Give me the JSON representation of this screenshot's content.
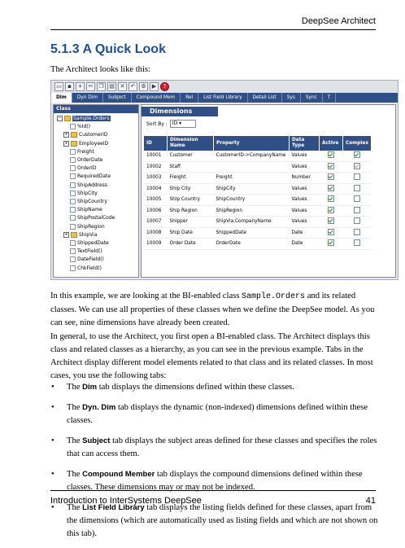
{
  "header": {
    "running_title": "DeepSee Architect"
  },
  "section_title": "5.1.3 A Quick Look",
  "intro": "The Architect looks like this:",
  "screenshot": {
    "tabs": [
      "Dim",
      "Dyn Dim",
      "Subject",
      "Compound Mem",
      "Rel",
      "List Field Library",
      "Detail List",
      "Sys",
      "Sync",
      "T"
    ],
    "class_panel_title": "Class",
    "tree": [
      {
        "label": "Sample.Orders",
        "kind": "root",
        "selected": true
      },
      {
        "label": "%Id()",
        "kind": "leaf"
      },
      {
        "label": "CustomerID",
        "kind": "folder"
      },
      {
        "label": "EmployeeID",
        "kind": "folder"
      },
      {
        "label": "Freight",
        "kind": "leaf"
      },
      {
        "label": "OrderDate",
        "kind": "leaf"
      },
      {
        "label": "OrderID",
        "kind": "leaf"
      },
      {
        "label": "RequiredDate",
        "kind": "leaf"
      },
      {
        "label": "ShipAddress",
        "kind": "leaf"
      },
      {
        "label": "ShipCity",
        "kind": "leaf"
      },
      {
        "label": "ShipCountry",
        "kind": "leaf"
      },
      {
        "label": "ShipName",
        "kind": "leaf"
      },
      {
        "label": "ShipPostalCode",
        "kind": "leaf"
      },
      {
        "label": "ShipRegion",
        "kind": "leaf"
      },
      {
        "label": "ShipVia",
        "kind": "folder"
      },
      {
        "label": "ShippedDate",
        "kind": "leaf"
      },
      {
        "label": "TextField()",
        "kind": "leaf"
      },
      {
        "label": "DateField()",
        "kind": "leaf"
      },
      {
        "label": "ChkField()",
        "kind": "leaf"
      }
    ],
    "panel_title": "Dimensions",
    "sort_label": "Sort By :",
    "sort_value": "ID",
    "columns": [
      "ID",
      "Dimension Name",
      "Property",
      "Data Type",
      "Active",
      "Complex"
    ],
    "rows": [
      {
        "id": "10001",
        "name": "Customer",
        "property": "CustomerID->CompanyName",
        "type": "Values",
        "active": true,
        "complex": true
      },
      {
        "id": "10002",
        "name": "Staff",
        "property": "",
        "type": "Values",
        "active": true,
        "complex": "grey"
      },
      {
        "id": "10003",
        "name": "Freight",
        "property": "Freight",
        "type": "Number",
        "active": true,
        "complex": false
      },
      {
        "id": "10004",
        "name": "Ship City",
        "property": "ShipCity",
        "type": "Values",
        "active": true,
        "complex": false
      },
      {
        "id": "10005",
        "name": "Ship Country",
        "property": "ShipCountry",
        "type": "Values",
        "active": true,
        "complex": false
      },
      {
        "id": "10006",
        "name": "Ship Region",
        "property": "ShipRegion",
        "type": "Values",
        "active": true,
        "complex": false
      },
      {
        "id": "10007",
        "name": "Shipper",
        "property": "ShipVia.CompanyName",
        "type": "Values",
        "active": true,
        "complex": false
      },
      {
        "id": "10008",
        "name": "Ship Date",
        "property": "ShippedDate",
        "type": "Date",
        "active": true,
        "complex": false
      },
      {
        "id": "10009",
        "name": "Order Date",
        "property": "OrderDate",
        "type": "Date",
        "active": true,
        "complex": false
      }
    ]
  },
  "para1": {
    "a": "In this example, we are looking at the BI-enabled class ",
    "code": "Sample.Orders",
    "b": " and its related classes. We can use all properties of these classes when we define the DeepSee model. As you can see, nine dimensions have already been created."
  },
  "para2": "In general, to use the Architect, you first open a BI-enabled class. The Architect displays this class and related classes as a hierarchy, as you can see in the previous example. Tabs in the Architect display different model elements related to that class and its related classes. In most cases, you use the following tabs:",
  "bullets": [
    {
      "pre": "The ",
      "tab": "Dim",
      "post": " tab displays the dimensions defined within these classes."
    },
    {
      "pre": "The ",
      "tab": "Dyn. Dim",
      "post": " tab displays the dynamic (non-indexed) dimensions defined within these classes."
    },
    {
      "pre": "The ",
      "tab": "Subject",
      "post": " tab displays the subject areas defined for these classes and specifies the roles that can access them."
    },
    {
      "pre": "The ",
      "tab": "Compound Member",
      "post": " tab displays the compound dimensions defined within these classes. These dimensions may or may not be indexed."
    },
    {
      "pre": "The ",
      "tab": "List Field Library",
      "post": " tab displays the listing fields defined for these classes, apart from the dimensions (which are automatically used as listing fields and which are not shown on this tab)."
    }
  ],
  "footer": {
    "left": "Introduction to InterSystems DeepSee",
    "page": "41"
  }
}
